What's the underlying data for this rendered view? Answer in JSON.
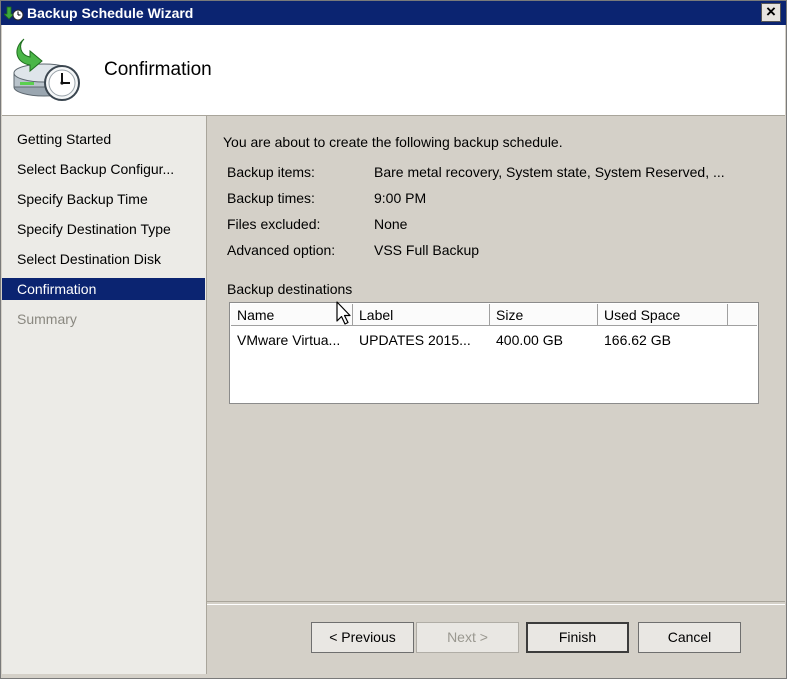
{
  "window": {
    "title": "Backup Schedule Wizard",
    "close_label": "×"
  },
  "header": {
    "title": "Confirmation"
  },
  "nav": {
    "items": [
      {
        "label": "Getting Started",
        "state": "normal"
      },
      {
        "label": "Select Backup Configur...",
        "state": "normal"
      },
      {
        "label": "Specify Backup Time",
        "state": "normal"
      },
      {
        "label": "Specify Destination Type",
        "state": "normal"
      },
      {
        "label": "Select Destination Disk",
        "state": "normal"
      },
      {
        "label": "Confirmation",
        "state": "selected"
      },
      {
        "label": "Summary",
        "state": "disabled"
      }
    ]
  },
  "main": {
    "intro": "You are about to create the following backup schedule.",
    "details": [
      {
        "label": "Backup items:",
        "value": "Bare metal recovery, System state, System Reserved, ..."
      },
      {
        "label": "Backup times:",
        "value": "9:00 PM"
      },
      {
        "label": "Files excluded:",
        "value": "None"
      },
      {
        "label": "Advanced option:",
        "value": "VSS Full Backup"
      }
    ],
    "destinations_label": "Backup destinations",
    "table": {
      "columns": [
        "Name",
        "Label",
        "Size",
        "Used Space"
      ],
      "rows": [
        [
          "VMware Virtua...",
          "UPDATES 2015...",
          "400.00 GB",
          "166.62 GB"
        ]
      ]
    }
  },
  "buttons": {
    "previous": "< Previous",
    "next": "Next >",
    "finish": "Finish",
    "cancel": "Cancel"
  },
  "colors": {
    "titlebar": "#0b2471",
    "selected": "#0b2471",
    "background": "#d4d0c8"
  },
  "icons": {
    "title": "backup-clock-icon",
    "header": "backup-disk-clock-icon"
  }
}
